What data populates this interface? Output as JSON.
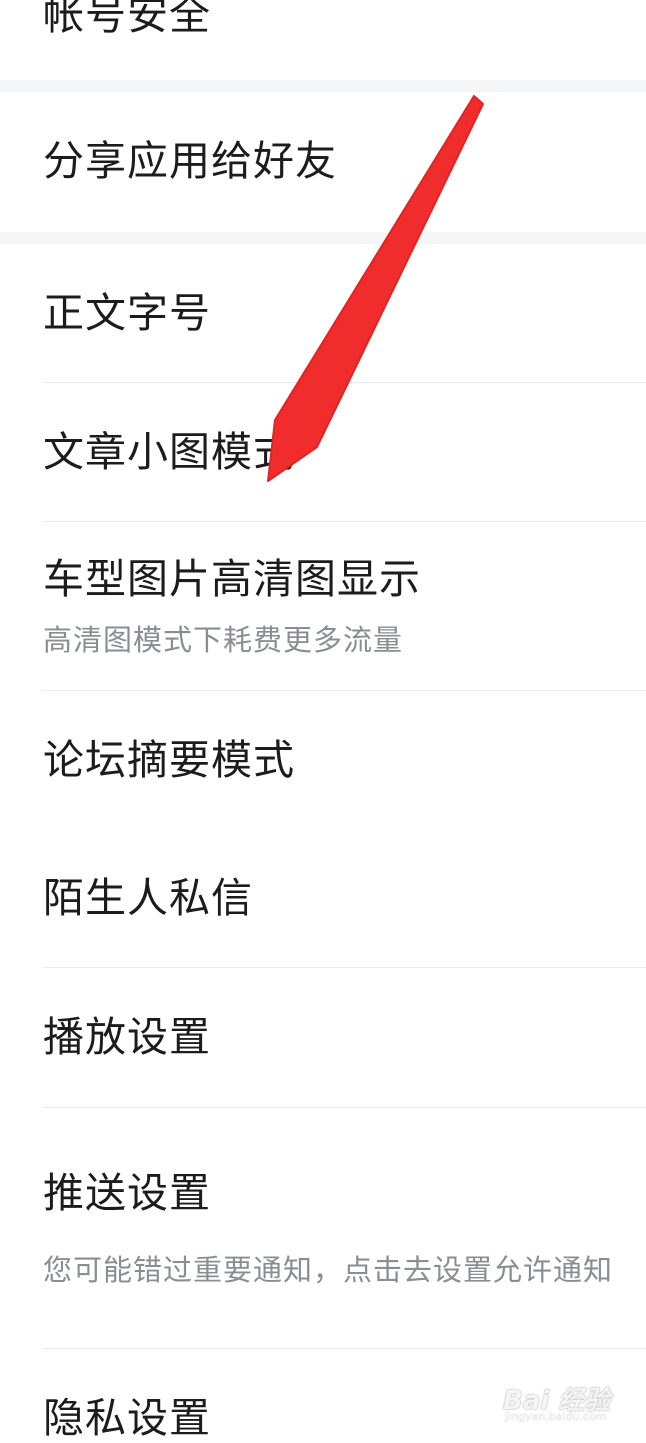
{
  "settings": {
    "account_security": "帐号安全",
    "share_app": "分享应用给好友",
    "font_size": "正文字号",
    "article_small_image": "文章小图模式",
    "hd_car_images": {
      "title": "车型图片高清图显示",
      "subtitle": "高清图模式下耗费更多流量"
    },
    "forum_summary": "论坛摘要模式",
    "stranger_messages": "陌生人私信",
    "playback": "播放设置",
    "push": {
      "title": "推送设置",
      "subtitle": "您可能错过重要通知，点击去设置允许通知"
    },
    "privacy": "隐私设置"
  },
  "watermark": {
    "brand": "Bai 经验",
    "url": "jingyan.baidu.com"
  },
  "colors": {
    "arrow": "#f02c2c",
    "section_gap": "#f5f6f8",
    "subtitle": "#8a8d93"
  }
}
